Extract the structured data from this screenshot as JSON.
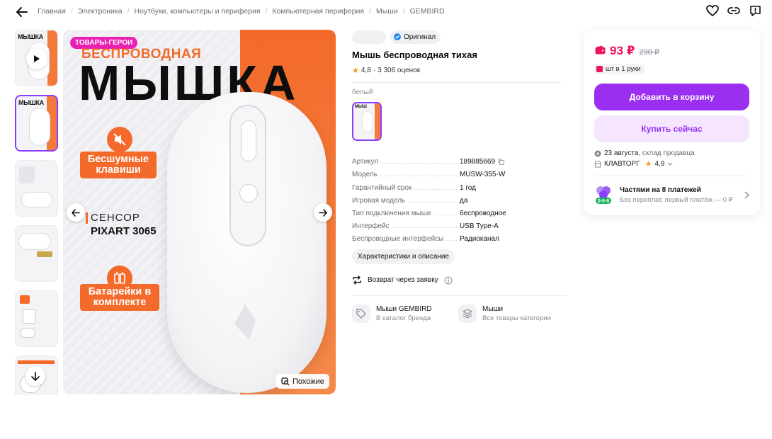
{
  "breadcrumbs": [
    "Главная",
    "Электроника",
    "Ноутбуки, компьютеры и периферия",
    "Компьютерная периферия",
    "Мыши",
    "GEMBIRD"
  ],
  "gallery": {
    "thumb_title": "МЫШКА",
    "badge": "ТОВАРЫ-ГЕРОИ",
    "subtitle": "БЕСПРОВОДНАЯ",
    "title": "МЫШКА",
    "feature1": "Бесшумные клавиши",
    "sensor_label": "СЕНСОР",
    "sensor_model": "PIXART 3065",
    "feature2": "Батарейки в комплекте",
    "similar_label": "Похожие"
  },
  "product": {
    "original_label": "Оригинал",
    "title": "Мышь беспроводная тихая",
    "rating": "4,8",
    "reviews": "3 306 оценок",
    "color_label": "белый",
    "color_swatch_text": "МЫШ",
    "specs": [
      {
        "name": "Артикул",
        "value": "189885669"
      },
      {
        "name": "Модель",
        "value": "MUSW-355-W"
      },
      {
        "name": "Гарантийный срок",
        "value": "1 год"
      },
      {
        "name": "Игровая модель",
        "value": "да"
      },
      {
        "name": "Тип подключения мыши",
        "value": "беспроводное"
      },
      {
        "name": "Интерфейс",
        "value": "USB Type-A"
      },
      {
        "name": "Беспроводные интерфейсы",
        "value": "Радиоканал"
      }
    ],
    "char_button": "Характеристики и описание",
    "return_text": "Возврат через заявку",
    "categories": [
      {
        "title": "Мыши GEMBIRD",
        "subtitle": "В каталог бренда"
      },
      {
        "title": "Мыши",
        "subtitle": "Все товары категории"
      }
    ]
  },
  "card": {
    "price": "93 ₽",
    "old_price": "290 ₽",
    "stock": "шт в 1 руки",
    "add_to_cart": "Добавить в корзину",
    "buy_now": "Купить сейчас",
    "delivery_date": "23 августа",
    "delivery_source": ", склад продавца",
    "seller_name": "КЛАВТОРГ",
    "seller_rating": "4,9",
    "installment_title": "Частями на 8 платежей",
    "installment_sub": "Без переплат, первый платёж — 0 ₽",
    "installment_badge": "0·0·8"
  },
  "colors": {
    "accent": "#9a2ff0",
    "price": "#f0145a",
    "orange": "#f36a2a",
    "hero_badge": "#ea1fb3"
  }
}
